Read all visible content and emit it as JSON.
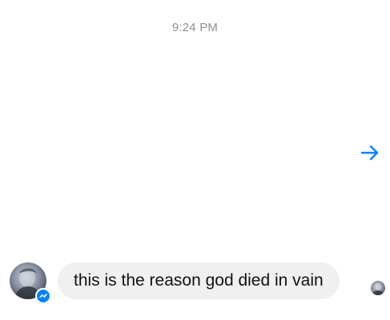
{
  "conversation": {
    "timestamp": "9:24 PM",
    "shared_item": {
      "share_icon": "share-arrow-icon",
      "accent_color": "#0084ff"
    },
    "message": {
      "text": "this is the reason god died in vain",
      "bubble_color": "#f1f0f0"
    },
    "sender": {
      "avatar_icon": "avatar",
      "badge_icon": "messenger-icon"
    },
    "read_receipt_icon": "seen-avatar"
  }
}
